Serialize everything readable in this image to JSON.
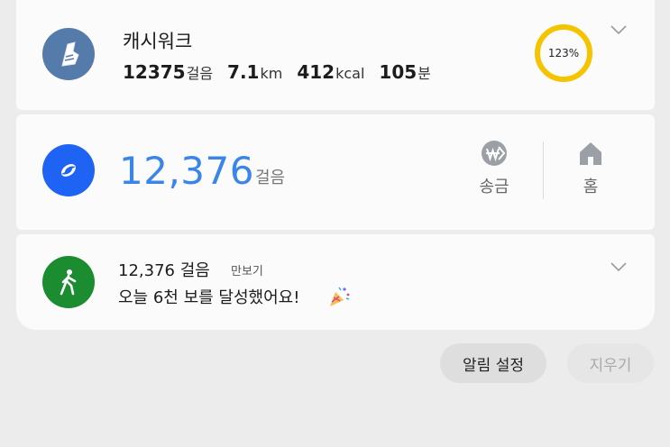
{
  "cashwalk": {
    "title": "캐시워크",
    "steps": "12375",
    "steps_unit": "걸음",
    "distance": "7.1",
    "distance_unit": "km",
    "calories": "412",
    "calories_unit": "kcal",
    "minutes": "105",
    "minutes_unit": "분",
    "goal_percent_label": "123%",
    "goal_ratio": 1.23,
    "ring_color": "#f5c400"
  },
  "toss": {
    "steps": "12,376",
    "steps_unit": "걸음",
    "send_label": "송금",
    "home_label": "홈",
    "accent": "#3a86e8"
  },
  "pedometer": {
    "title": "12,376 걸음",
    "app_name": "만보기",
    "body": "오늘 6천 보를 달성했어요!",
    "icon_color": "#1b8c2f"
  },
  "footer": {
    "settings_label": "알림 설정",
    "clear_label": "지우기"
  }
}
